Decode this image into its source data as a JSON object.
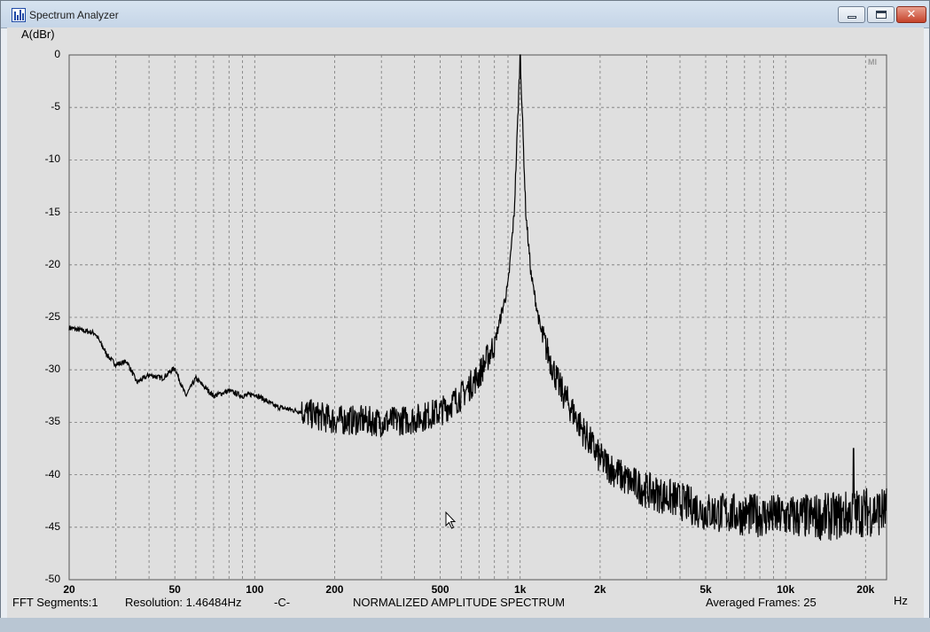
{
  "window": {
    "title": "Spectrum Analyzer",
    "controls": {
      "close_glyph": "✕"
    }
  },
  "plot": {
    "y_axis_label": "A(dBr)",
    "x_unit_label": "Hz",
    "corner_logo": "MI",
    "y_ticks": [
      "0",
      "-5",
      "-10",
      "-15",
      "-20",
      "-25",
      "-30",
      "-35",
      "-40",
      "-45",
      "-50"
    ],
    "x_ticks": [
      "20",
      "50",
      "100",
      "200",
      "500",
      "1k",
      "2k",
      "5k",
      "10k",
      "20k"
    ]
  },
  "status": {
    "fft_segments": "FFT Segments:1",
    "resolution": "Resolution: 1.46484Hz",
    "channel": "-C-",
    "mode": "NORMALIZED AMPLITUDE SPECTRUM",
    "averaged_frames": "Averaged Frames: 25"
  },
  "chart_data": {
    "type": "line",
    "title": "NORMALIZED AMPLITUDE SPECTRUM",
    "xlabel": "Hz",
    "ylabel": "A(dBr)",
    "x_scale": "log",
    "xlim": [
      20,
      24000
    ],
    "ylim": [
      -50,
      0
    ],
    "grid": true,
    "series": [
      {
        "x": [
          20,
          22,
          25,
          28,
          30,
          33,
          36,
          40,
          45,
          50,
          55,
          60,
          70,
          80,
          90,
          100,
          120,
          150,
          180,
          200,
          250,
          300,
          400,
          500,
          600,
          700,
          800,
          900,
          950,
          1000,
          1050,
          1100,
          1200,
          1400,
          1700,
          2000,
          2500,
          3000,
          4000,
          5000,
          7000,
          10000,
          15000,
          20000,
          24000
        ],
        "y": [
          -26,
          -26.2,
          -26.5,
          -28.7,
          -29.5,
          -29.2,
          -31.2,
          -30.5,
          -30.8,
          -29.8,
          -32.5,
          -30.8,
          -32.5,
          -32.0,
          -32.5,
          -32.3,
          -33.5,
          -34.0,
          -34.5,
          -34.8,
          -34.8,
          -35.0,
          -34.7,
          -34.0,
          -32.5,
          -30.5,
          -27.5,
          -22.0,
          -15.0,
          0,
          -15.0,
          -21.0,
          -26.5,
          -31.5,
          -35.5,
          -38.5,
          -40.5,
          -41.5,
          -42.5,
          -43.5,
          -43.8,
          -44.0,
          -44.0,
          -43.5,
          -43.5
        ]
      }
    ],
    "spur": {
      "x": 18000,
      "y": -37.5
    },
    "noise_band_db": 1.6
  }
}
